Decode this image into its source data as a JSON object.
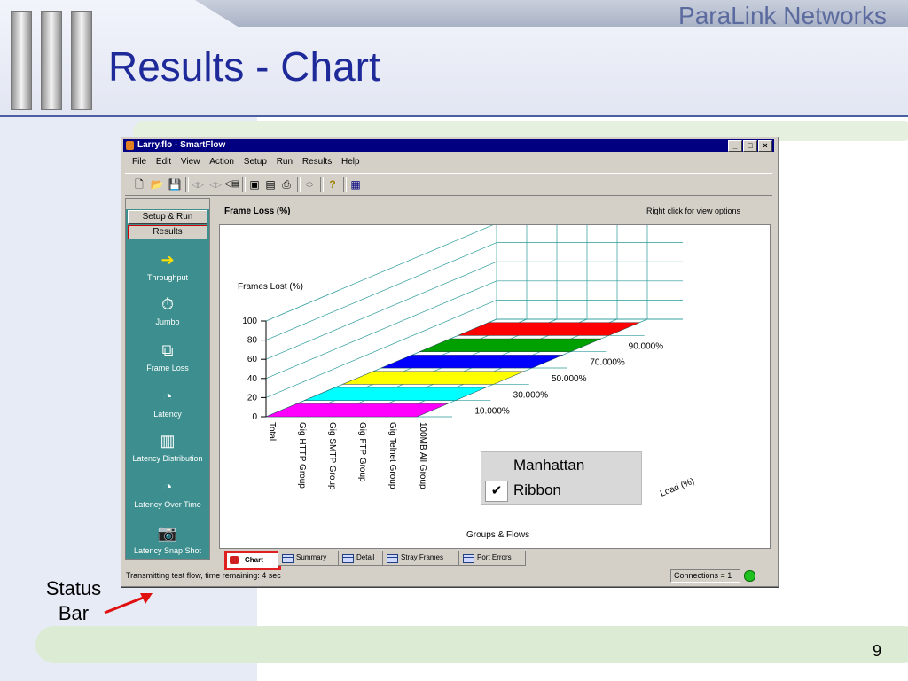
{
  "slide": {
    "title": "Results - Chart",
    "brand": "ParaLink Networks",
    "page_number": "9",
    "callout_line1": "Status",
    "callout_line2": "Bar"
  },
  "window": {
    "title": "Larry.flo - SmartFlow",
    "controls": [
      "_",
      "□",
      "×"
    ]
  },
  "menu": [
    "File",
    "Edit",
    "View",
    "Action",
    "Setup",
    "Run",
    "Results",
    "Help"
  ],
  "toolbar": {
    "icons": [
      "new-icon",
      "open-icon",
      "save-icon",
      "prev-icon",
      "next-icon",
      "back-icon",
      "copy-icon",
      "paste-icon",
      "print-icon",
      "stop-icon",
      "help-icon",
      "report-icon"
    ]
  },
  "nav": {
    "setup_run": "Setup & Run",
    "results": "Results",
    "items": [
      "Throughput",
      "Jumbo",
      "Frame Loss",
      "Latency",
      "Latency Distribution",
      "Latency Over Time",
      "Latency Snap Shot"
    ]
  },
  "pane": {
    "title": "Frame Loss (%)",
    "hint": "Right click for view options"
  },
  "legend": {
    "items": [
      "Manhattan",
      "Ribbon"
    ],
    "checked": [
      false,
      true
    ]
  },
  "tabs": [
    "Chart",
    "Summary",
    "Detail",
    "Stray Frames",
    "Port Errors"
  ],
  "status": {
    "text": "Transmitting test flow, time remaining: 4 sec",
    "connections": "Connections = 1"
  },
  "chart_data": {
    "type": "ribbon-3d",
    "ylabel": "Frames Lost (%)",
    "xlabel": "Groups & Flows",
    "zlabel": "Load (%)",
    "categories": [
      "Total",
      "Gig HTTP Group",
      "Gig SMTP Group",
      "Gig FTP Group",
      "Gig Telnet Group",
      "100MB All Group"
    ],
    "yticks": [
      0,
      20,
      40,
      60,
      80,
      100
    ],
    "ylim": [
      0,
      100
    ],
    "series": [
      {
        "name": "10.000%",
        "color": "#ff00ff",
        "values": [
          0,
          0,
          0,
          0,
          0,
          0
        ]
      },
      {
        "name": "30.000%",
        "color": "#00ffff",
        "values": [
          0,
          0,
          0,
          0,
          0,
          0
        ]
      },
      {
        "name": "50.000%",
        "color": "#ffff00",
        "values": [
          0,
          0,
          0,
          0,
          0,
          0
        ]
      },
      {
        "name": "70.000%",
        "color": "#0000ff",
        "values": [
          0,
          0,
          0,
          0,
          0,
          0
        ]
      },
      {
        "name": "90.000%",
        "color": "#00a000",
        "values": [
          0,
          0,
          0,
          0,
          0,
          0
        ]
      },
      {
        "name": "",
        "color": "#ff0000",
        "values": [
          0,
          0,
          0,
          0,
          0,
          0
        ]
      }
    ]
  }
}
